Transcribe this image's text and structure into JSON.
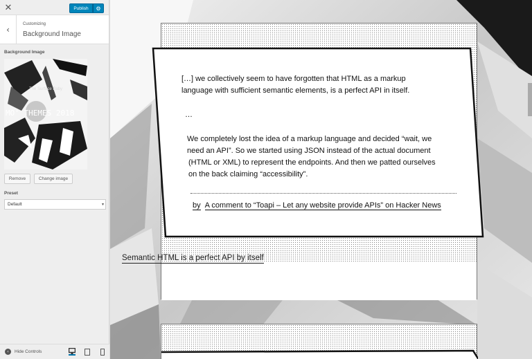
{
  "sidebar": {
    "close_icon": "close-icon",
    "publish_label": "Publish",
    "customizing_label": "Customizing",
    "section_title": "Background Image",
    "background_image_label": "Background Image",
    "thumbnail": {
      "title_line": "The Surface Baby",
      "brand_text": "MO' THEMES 2018"
    },
    "remove_label": "Remove",
    "change_image_label": "Change image",
    "preset_label": "Preset",
    "preset_value": "Default",
    "hide_controls_label": "Hide Controls",
    "device_icons": [
      "desktop-icon",
      "tablet-icon",
      "mobile-icon"
    ],
    "accent_color": "#0085ba"
  },
  "preview": {
    "quote": {
      "line1": "[…] we collectively seem to have forgotten that HTML as a markup",
      "line2": "language with sufficient semantic elements, is a perfect API in itself.",
      "ellipsis": "…",
      "para_line1": "We completely lost the idea of a markup language and decided “wait, we",
      "para_line2": "need an API”. So we started using JSON instead of the actual document",
      "para_line3": "(HTML or XML) to represent the endpoints. And then we patted ourselves",
      "para_line4": "on the back claiming “accessibility”."
    },
    "byline_prefix": "by",
    "citation": "A  comment to “Toapi – Let any website provide APIs” on Hacker News",
    "post_link": "Semantic HTML is a perfect API by itself"
  }
}
